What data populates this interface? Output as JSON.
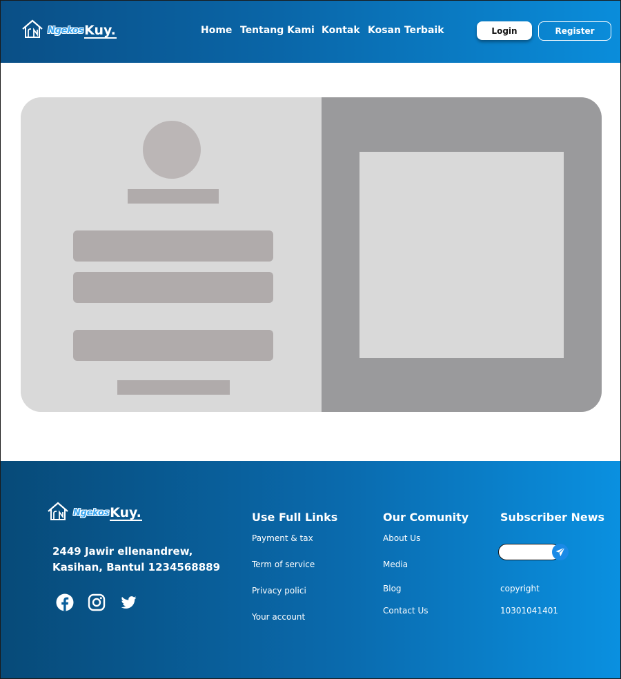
{
  "brand": {
    "prefix": "Ngekos",
    "suffix": "Kuy."
  },
  "nav": [
    {
      "label": "Home"
    },
    {
      "label": "Tentang Kami"
    },
    {
      "label": "Kontak"
    },
    {
      "label": "Kosan Terbaik"
    }
  ],
  "auth": {
    "login_label": "Login",
    "register_label": "Register"
  },
  "footer": {
    "address_line1": "2449 Jawir ellenandrew,",
    "address_line2": "Kasihan, Bantul 1234568889",
    "social_icons": [
      "facebook-icon",
      "instagram-icon",
      "twitter-icon"
    ],
    "useful_links": {
      "title": "Use Full Links",
      "items": [
        "Payment & tax",
        "Term of  service",
        "Privacy polici",
        "Your account"
      ]
    },
    "community": {
      "title": "Our Comunity",
      "items": [
        "About Us",
        "Media",
        "Blog",
        "Contact Us"
      ]
    },
    "subscribe": {
      "title": "Subscriber News",
      "input_placeholder": "",
      "send_icon": "send-icon",
      "copyright": "copyright",
      "number": "10301041401"
    }
  },
  "colors": {
    "header_gradient_start": "#0a4f86",
    "header_gradient_end": "#0a8ddb",
    "brand_accent": "#3aa6f0",
    "card_left": "#d9d9d9",
    "card_right": "#9a9a9c",
    "placeholder_block": "#b0abab",
    "send_button": "#1a8ae6"
  }
}
